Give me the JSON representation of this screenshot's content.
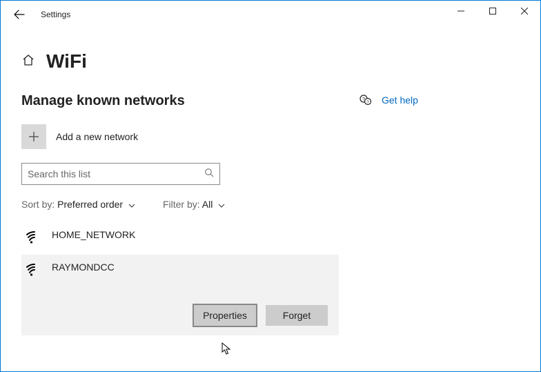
{
  "titlebar": {
    "app_title": "Settings"
  },
  "heading": "WiFi",
  "section": "Manage known networks",
  "add_network_label": "Add a new network",
  "search": {
    "placeholder": "Search this list"
  },
  "sort": {
    "label": "Sort by:",
    "value": "Preferred order"
  },
  "filter": {
    "label": "Filter by:",
    "value": "All"
  },
  "networks": [
    {
      "name": "HOME_NETWORK"
    },
    {
      "name": "RAYMONDCC"
    }
  ],
  "buttons": {
    "properties": "Properties",
    "forget": "Forget"
  },
  "help": {
    "label": "Get help"
  }
}
